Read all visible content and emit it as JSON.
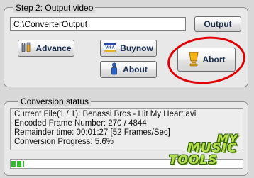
{
  "step2": {
    "legend": "Step 2: Output video",
    "output_path": "C:\\ConverterOutput",
    "output_button": "Output",
    "advance_button": "Advance",
    "buynow_button": "Buynow",
    "about_button": "About",
    "abort_button": "Abort"
  },
  "status": {
    "legend": "Conversion status",
    "current_file": "Current File(1 / 1): Benassi Bros - Hit My Heart.avi",
    "encoded_frames": "Encoded Frame Number: 270 / 4844",
    "remainder_time": "Remainder time: 00:01:27 [52 Frames/Sec]",
    "progress_text": "Conversion Progress: 5.6%",
    "progress_value": 0.056
  },
  "logo": {
    "line1": "MY",
    "line2": "MUSIC",
    "line3": "TOOLS"
  },
  "colors": {
    "annotation_circle": "#e00000",
    "progress_green": "#2fbd2f",
    "logo_green": "#b9e04a"
  },
  "icons": {
    "advance": "tools-icon",
    "buynow": "credit-card-icon",
    "about": "info-icon",
    "abort": "cup-icon"
  }
}
